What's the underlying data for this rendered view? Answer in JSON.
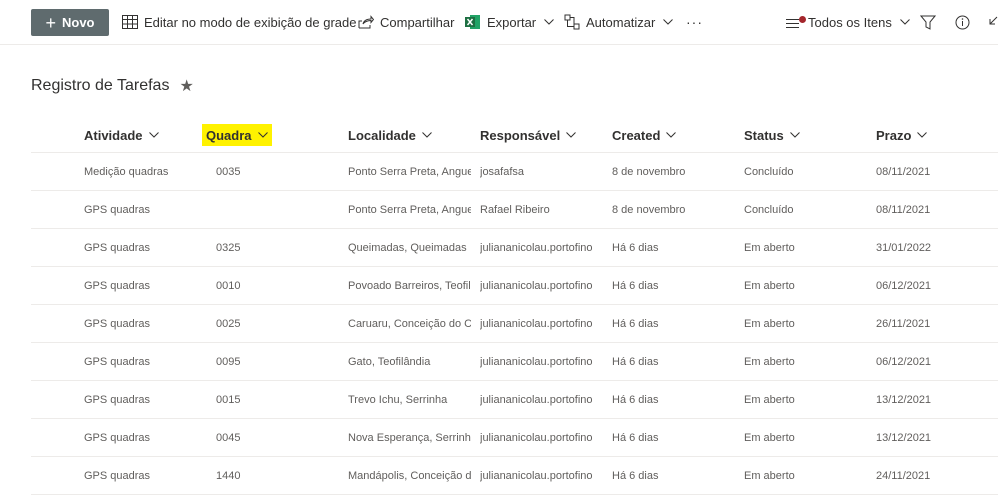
{
  "toolbar": {
    "new_label": "Novo",
    "grid_label": "Editar no modo de exibição de grade",
    "share_label": "Compartilhar",
    "export_label": "Exportar",
    "automate_label": "Automatizar",
    "more_label": "···",
    "view_label": "Todos os Itens"
  },
  "list": {
    "title": "Registro de Tarefas",
    "star": "★"
  },
  "columns": [
    "Atividade",
    "Quadra",
    "Localidade",
    "Responsável",
    "Created",
    "Status",
    "Prazo"
  ],
  "rows": [
    [
      "Medição quadras",
      "0035",
      "Ponto Serra Preta, Anguera",
      "josafafsa",
      "8 de novembro",
      "Concluído",
      "08/11/2021"
    ],
    [
      "GPS quadras",
      "",
      "Ponto Serra Preta, Anguera",
      "Rafael Ribeiro",
      "8 de novembro",
      "Concluído",
      "08/11/2021"
    ],
    [
      "GPS quadras",
      "0325",
      "Queimadas, Queimadas",
      "juliananicolau.portofino",
      "Há 6 dias",
      "Em aberto",
      "31/01/2022"
    ],
    [
      "GPS quadras",
      "0010",
      "Povoado Barreiros, Teofilândia",
      "juliananicolau.portofino",
      "Há 6 dias",
      "Em aberto",
      "06/12/2021"
    ],
    [
      "GPS quadras",
      "0025",
      "Caruaru, Conceição do Coité",
      "juliananicolau.portofino",
      "Há 6 dias",
      "Em aberto",
      "26/11/2021"
    ],
    [
      "GPS quadras",
      "0095",
      "Gato, Teofilândia",
      "juliananicolau.portofino",
      "Há 6 dias",
      "Em aberto",
      "06/12/2021"
    ],
    [
      "GPS quadras",
      "0015",
      "Trevo Ichu, Serrinha",
      "juliananicolau.portofino",
      "Há 6 dias",
      "Em aberto",
      "13/12/2021"
    ],
    [
      "GPS quadras",
      "0045",
      "Nova Esperança, Serrinha",
      "juliananicolau.portofino",
      "Há 6 dias",
      "Em aberto",
      "13/12/2021"
    ],
    [
      "GPS quadras",
      "1440",
      "Mandápolis, Conceição do Coité",
      "juliananicolau.portofino",
      "Há 6 dias",
      "Em aberto",
      "24/11/2021"
    ]
  ],
  "colors": {
    "new_button": "#5f6b6e",
    "highlight": "#fff200",
    "excel_green": "#1d6f42",
    "notification_dot": "#a4262c"
  }
}
